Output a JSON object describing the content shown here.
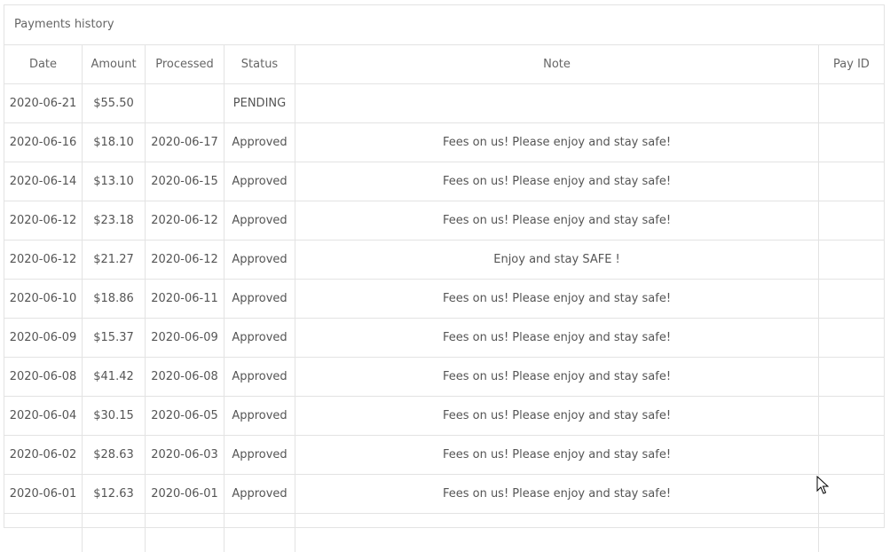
{
  "panel": {
    "title": "Payments history"
  },
  "table": {
    "headers": {
      "date": "Date",
      "amount": "Amount",
      "processed": "Processed",
      "status": "Status",
      "note": "Note",
      "pay_id": "Pay ID"
    },
    "rows": [
      {
        "date": "2020-06-21",
        "amount": "$55.50",
        "processed": "",
        "status": "PENDING",
        "note": "",
        "pay_id": ""
      },
      {
        "date": "2020-06-16",
        "amount": "$18.10",
        "processed": "2020-06-17",
        "status": "Approved",
        "note": "Fees on us! Please enjoy and stay safe!",
        "pay_id": ""
      },
      {
        "date": "2020-06-14",
        "amount": "$13.10",
        "processed": "2020-06-15",
        "status": "Approved",
        "note": "Fees on us! Please enjoy and stay safe!",
        "pay_id": ""
      },
      {
        "date": "2020-06-12",
        "amount": "$23.18",
        "processed": "2020-06-12",
        "status": "Approved",
        "note": "Fees on us! Please enjoy and stay safe!",
        "pay_id": ""
      },
      {
        "date": "2020-06-12",
        "amount": "$21.27",
        "processed": "2020-06-12",
        "status": "Approved",
        "note": "Enjoy and stay SAFE !",
        "pay_id": ""
      },
      {
        "date": "2020-06-10",
        "amount": "$18.86",
        "processed": "2020-06-11",
        "status": "Approved",
        "note": "Fees on us! Please enjoy and stay safe!",
        "pay_id": ""
      },
      {
        "date": "2020-06-09",
        "amount": "$15.37",
        "processed": "2020-06-09",
        "status": "Approved",
        "note": "Fees on us! Please enjoy and stay safe!",
        "pay_id": ""
      },
      {
        "date": "2020-06-08",
        "amount": "$41.42",
        "processed": "2020-06-08",
        "status": "Approved",
        "note": "Fees on us! Please enjoy and stay safe!",
        "pay_id": ""
      },
      {
        "date": "2020-06-04",
        "amount": "$30.15",
        "processed": "2020-06-05",
        "status": "Approved",
        "note": "Fees on us! Please enjoy and stay safe!",
        "pay_id": ""
      },
      {
        "date": "2020-06-02",
        "amount": "$28.63",
        "processed": "2020-06-03",
        "status": "Approved",
        "note": "Fees on us! Please enjoy and stay safe!",
        "pay_id": ""
      },
      {
        "date": "2020-06-01",
        "amount": "$12.63",
        "processed": "2020-06-01",
        "status": "Approved",
        "note": "Fees on us! Please enjoy and stay safe!",
        "pay_id": ""
      },
      {
        "date": "",
        "amount": "",
        "processed": "",
        "status": "",
        "note": "",
        "pay_id": ""
      }
    ]
  },
  "colors": {
    "border": "#e3e3e3",
    "text": "#555555"
  },
  "icons": {
    "cursor": "mouse-pointer-icon"
  }
}
